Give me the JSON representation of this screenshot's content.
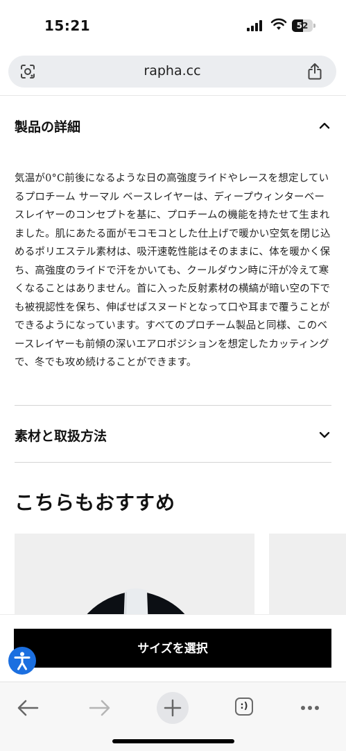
{
  "status_bar": {
    "time": "15:21",
    "battery": "52",
    "battery_level": 0.52
  },
  "browser": {
    "url": "rapha.cc",
    "tab_label": ":)"
  },
  "product_details": {
    "title": "製品の詳細",
    "description": "気温が0°C前後になるような日の高強度ライドやレースを想定しているプロチーム サーマル ベースレイヤーは、ディープウィンターベースレイヤーのコンセプトを基に、プロチームの機能を持たせて生まれました。肌にあたる面がモコモコとした仕上げで暖かい空気を閉じ込めるポリエステル素材は、吸汗速乾性能はそのままに、体を暖かく保ち、高強度のライドで汗をかいても、クールダウン時に汗が冷えて寒くなることはありません。首に入った反射素材の横縞が暗い空の下でも被視認性を保ち、伸ばせばスヌードとなって口や耳まで覆うことができるようになっています。すべてのプロチーム製品と同様、このベースレイヤーも前傾の深いエアロポジションを想定したカッティングで、冬でも攻め続けることができます。"
  },
  "materials": {
    "title": "素材と取扱方法"
  },
  "recommendations": {
    "title": "こちらもおすすめ"
  },
  "cta": {
    "select_size": "サイズを選択"
  },
  "colors": {
    "accent_blue": "#1b6fe0",
    "button_black": "#000000"
  }
}
